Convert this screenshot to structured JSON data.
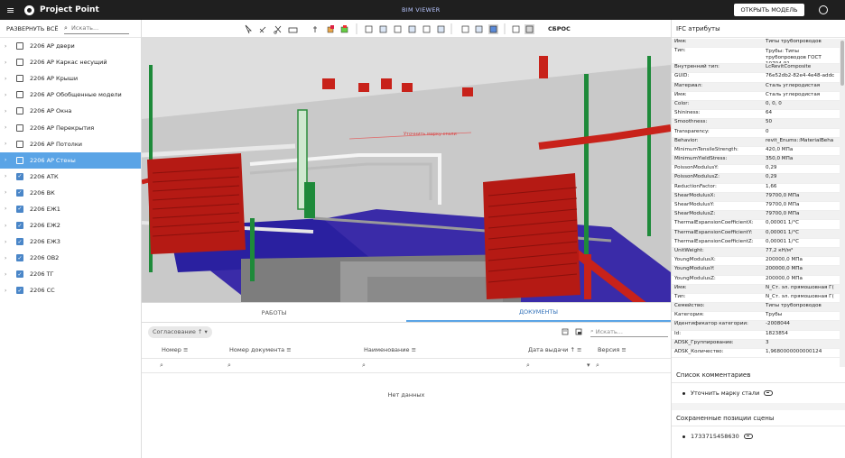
{
  "topbar": {
    "brand": "Project Point",
    "center_title": "BIM VIEWER",
    "open_model": "ОТКРЫТЬ МОДЕЛЬ"
  },
  "left_panel": {
    "expand_all": "РАЗВЕРНУТЬ ВСЁ",
    "search_placeholder": "Искать...",
    "items": [
      {
        "label": "2206 АР двери",
        "checked": false
      },
      {
        "label": "2206 АР Каркас несущий",
        "checked": false
      },
      {
        "label": "2206 АР Крыши",
        "checked": false
      },
      {
        "label": "2206 АР Обобщенные модели",
        "checked": false
      },
      {
        "label": "2206 АР Окна",
        "checked": false
      },
      {
        "label": "2206 АР Перекрытия",
        "checked": false
      },
      {
        "label": "2206 АР Потолки",
        "checked": false
      },
      {
        "label": "2206 АР Стены",
        "checked": false,
        "selected": true
      },
      {
        "label": "2206 АТК",
        "checked": true
      },
      {
        "label": "2206 ВК",
        "checked": true
      },
      {
        "label": "2206 ЕЖ1",
        "checked": true
      },
      {
        "label": "2206 ЕЖ2",
        "checked": true
      },
      {
        "label": "2206 ЕЖ3",
        "checked": true
      },
      {
        "label": "2206 ОВ2",
        "checked": true
      },
      {
        "label": "2206 ТГ",
        "checked": true
      },
      {
        "label": "2206 СС",
        "checked": true
      }
    ]
  },
  "viewer": {
    "reset_label": "СБРОС",
    "annotation": "Уточнить марку стали"
  },
  "bottom_panel": {
    "tabs": [
      {
        "label": "РАБОТЫ",
        "active": false
      },
      {
        "label": "ДОКУМЕНТЫ",
        "active": true
      }
    ],
    "filter_chip": "Согласование",
    "search_placeholder": "Искать...",
    "columns": [
      "Номер",
      "Номер документа",
      "Наименование",
      "Дата выдачи",
      "Версия"
    ],
    "empty_text": "Нет данных"
  },
  "right_panel": {
    "ifc_title": "IFC атрибуты",
    "attributes": [
      {
        "k": "Имя:",
        "v": "Типы трубопроводов"
      },
      {
        "k": "Тип:",
        "v": "Трубы: Типы трубопроводов ГОСТ 10704-91",
        "tall": true
      },
      {
        "k": "Внутренний тип:",
        "v": "LcRevitComposite"
      },
      {
        "k": "GUID:",
        "v": "76e52db2-82e4-4e48-addc"
      },
      {
        "k": "Материал:",
        "v": "Сталь углеродистая"
      },
      {
        "k": "Имя:",
        "v": "Сталь углеродистая"
      },
      {
        "k": "Color:",
        "v": "0, 0, 0"
      },
      {
        "k": "Shininess:",
        "v": "64"
      },
      {
        "k": "Smoothness:",
        "v": "50"
      },
      {
        "k": "Transparency:",
        "v": "0"
      },
      {
        "k": "Behavior:",
        "v": "revit_Enums::MaterialBeha"
      },
      {
        "k": "MinimumTensileStrength:",
        "v": "420,0 МПа"
      },
      {
        "k": "MinimumYieldStress:",
        "v": "350,0 МПа"
      },
      {
        "k": "PoissonModulusY:",
        "v": "0,29"
      },
      {
        "k": "PoissonModulusZ:",
        "v": "0,29"
      },
      {
        "k": "ReductionFactor:",
        "v": "1,66"
      },
      {
        "k": "ShearModulusX:",
        "v": "79700,0 МПа"
      },
      {
        "k": "ShearModulusY:",
        "v": "79700,0 МПа"
      },
      {
        "k": "ShearModulusZ:",
        "v": "79700,0 МПа"
      },
      {
        "k": "ThermalExpansionCoefficientX:",
        "v": "0,00001 1/°C"
      },
      {
        "k": "ThermalExpansionCoefficientY:",
        "v": "0,00001 1/°C"
      },
      {
        "k": "ThermalExpansionCoefficientZ:",
        "v": "0,00001 1/°C"
      },
      {
        "k": "UnitWeight:",
        "v": "77,2 кН/м³"
      },
      {
        "k": "YoungModulusX:",
        "v": "200000,0 МПа"
      },
      {
        "k": "YoungModulusY:",
        "v": "200000,0 МПа"
      },
      {
        "k": "YoungModulusZ:",
        "v": "200000,0 МПа"
      },
      {
        "k": "Имя:",
        "v": "N_Ст. эл. прямошовная Г("
      },
      {
        "k": "Тип:",
        "v": "N_Ст. эл. прямошовная Г("
      },
      {
        "k": "Семейство:",
        "v": "Типы трубопроводов"
      },
      {
        "k": "Категория:",
        "v": "Трубы"
      },
      {
        "k": "Идентификатор категории:",
        "v": "-2008044"
      },
      {
        "k": "Id:",
        "v": "1823854"
      },
      {
        "k": "ADSK_Группирование:",
        "v": "3"
      },
      {
        "k": "ADSK_Количество:",
        "v": "1,9680000000000124"
      }
    ],
    "comments_title": "Список комментариев",
    "comments": [
      "Уточнить марку стали"
    ],
    "positions_title": "Сохраненные позиции сцены",
    "positions": [
      "1733715458630"
    ]
  }
}
